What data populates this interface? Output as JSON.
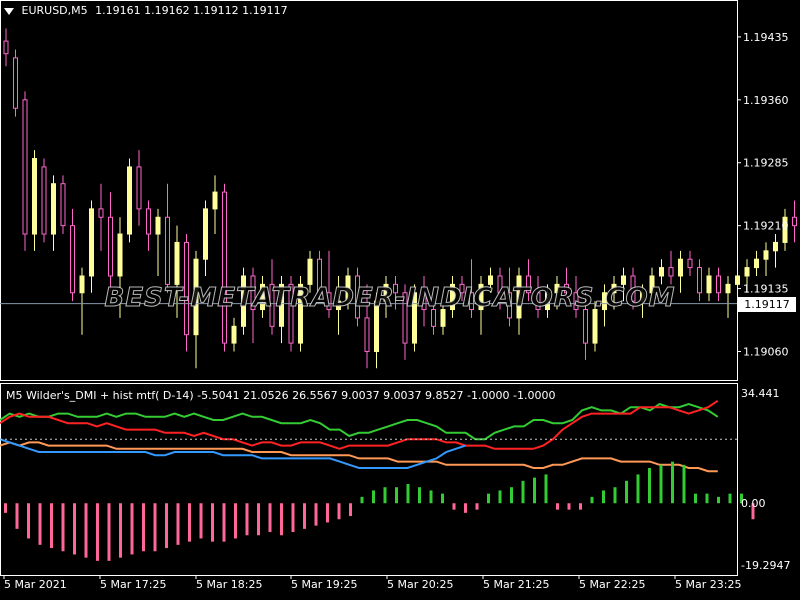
{
  "main_chart": {
    "symbol": "EURUSD,M5",
    "ohlc": [
      "1.19161",
      "1.19162",
      "1.19112",
      "1.19117"
    ],
    "current_price": "1.19117",
    "watermark": "BEST-METATRADER-INDICATORS.COM",
    "colors": {
      "bull": "#ffff99",
      "bear": "#ff66cc",
      "price_line": "#8899aa",
      "price_box": "#ffffff"
    }
  },
  "indicator": {
    "header": "M5 Wilder's_DMI + hist mtf( D-14) -5.5041 21.0526 26.5567 9.0037 9.0037 9.8527 -1.0000 -1.0000",
    "colors": {
      "plus_di": "#33cc33",
      "minus_di": "#ff2222",
      "adx": "#ff9955",
      "adxr": "#3399ff",
      "hist_pos": "#33cc33",
      "hist_neg": "#ff6699"
    }
  },
  "chart_data": [
    {
      "type": "candlestick",
      "title": "EURUSD,M5",
      "y_ticks": [
        "1.19435",
        "1.19360",
        "1.19285",
        "1.19210",
        "1.19135",
        "1.19060"
      ],
      "ylim": [
        1.19026,
        1.19479
      ],
      "x_ticks": [
        "5 Mar 2021",
        "5 Mar 17:25",
        "5 Mar 18:25",
        "5 Mar 19:25",
        "5 Mar 20:25",
        "5 Mar 21:25",
        "5 Mar 22:25",
        "5 Mar 23:25"
      ],
      "current_price": 1.19117,
      "candles": [
        [
          1.1943,
          1.19445,
          1.194,
          1.19415
        ],
        [
          1.1941,
          1.1942,
          1.1934,
          1.1935
        ],
        [
          1.1936,
          1.1937,
          1.1918,
          1.192
        ],
        [
          1.192,
          1.193,
          1.1918,
          1.1929
        ],
        [
          1.1928,
          1.1929,
          1.1919,
          1.192
        ],
        [
          1.192,
          1.1927,
          1.1918,
          1.1926
        ],
        [
          1.1926,
          1.1927,
          1.192,
          1.1921
        ],
        [
          1.1921,
          1.1923,
          1.1912,
          1.1913
        ],
        [
          1.1913,
          1.1916,
          1.1908,
          1.1915
        ],
        [
          1.1915,
          1.1924,
          1.1913,
          1.1923
        ],
        [
          1.1923,
          1.1926,
          1.1918,
          1.1922
        ],
        [
          1.1922,
          1.1925,
          1.1913,
          1.1915
        ],
        [
          1.1915,
          1.1922,
          1.191,
          1.192
        ],
        [
          1.192,
          1.1929,
          1.1919,
          1.1928
        ],
        [
          1.1928,
          1.193,
          1.1921,
          1.1923
        ],
        [
          1.1923,
          1.1924,
          1.1918,
          1.192
        ],
        [
          1.192,
          1.1923,
          1.1915,
          1.1922
        ],
        [
          1.1922,
          1.1926,
          1.1913,
          1.1914
        ],
        [
          1.1914,
          1.1921,
          1.191,
          1.1919
        ],
        [
          1.1919,
          1.192,
          1.1906,
          1.1908
        ],
        [
          1.1908,
          1.1918,
          1.1904,
          1.1917
        ],
        [
          1.1917,
          1.1924,
          1.1915,
          1.1923
        ],
        [
          1.1923,
          1.1927,
          1.192,
          1.1925
        ],
        [
          1.1925,
          1.1926,
          1.1906,
          1.1907
        ],
        [
          1.1907,
          1.191,
          1.1906,
          1.1909
        ],
        [
          1.1909,
          1.1916,
          1.1908,
          1.1915
        ],
        [
          1.1915,
          1.1916,
          1.1907,
          1.1911
        ],
        [
          1.1911,
          1.1915,
          1.191,
          1.1914
        ],
        [
          1.1914,
          1.1917,
          1.1908,
          1.1909
        ],
        [
          1.1909,
          1.1915,
          1.1907,
          1.1914
        ],
        [
          1.1914,
          1.1915,
          1.1906,
          1.1907
        ],
        [
          1.1907,
          1.1915,
          1.1906,
          1.1914
        ],
        [
          1.1914,
          1.1918,
          1.1913,
          1.1917
        ],
        [
          1.1917,
          1.1918,
          1.1912,
          1.1913
        ],
        [
          1.1913,
          1.1918,
          1.191,
          1.1911
        ],
        [
          1.1911,
          1.1915,
          1.1908,
          1.1912
        ],
        [
          1.1912,
          1.1916,
          1.1911,
          1.1915
        ],
        [
          1.1915,
          1.1916,
          1.1909,
          1.191
        ],
        [
          1.191,
          1.1914,
          1.1904,
          1.1906
        ],
        [
          1.1906,
          1.1913,
          1.1904,
          1.1912
        ],
        [
          1.1912,
          1.1915,
          1.191,
          1.1914
        ],
        [
          1.1914,
          1.1915,
          1.1911,
          1.1913
        ],
        [
          1.1913,
          1.1914,
          1.1905,
          1.1907
        ],
        [
          1.1907,
          1.1914,
          1.1906,
          1.1913
        ],
        [
          1.1913,
          1.1915,
          1.1909,
          1.1911
        ],
        [
          1.1911,
          1.1913,
          1.1908,
          1.1909
        ],
        [
          1.1909,
          1.1912,
          1.1908,
          1.1911
        ],
        [
          1.1911,
          1.1915,
          1.191,
          1.1914
        ],
        [
          1.1914,
          1.1915,
          1.1912,
          1.1913
        ],
        [
          1.1913,
          1.1917,
          1.191,
          1.1911
        ],
        [
          1.1911,
          1.1915,
          1.1908,
          1.1914
        ],
        [
          1.1914,
          1.1916,
          1.1913,
          1.1915
        ],
        [
          1.1915,
          1.1916,
          1.1911,
          1.1913
        ],
        [
          1.1913,
          1.1916,
          1.1909,
          1.191
        ],
        [
          1.191,
          1.1916,
          1.1908,
          1.1915
        ],
        [
          1.1915,
          1.1917,
          1.1912,
          1.1913
        ],
        [
          1.1913,
          1.1915,
          1.191,
          1.1911
        ],
        [
          1.1911,
          1.1914,
          1.191,
          1.1913
        ],
        [
          1.1913,
          1.1915,
          1.1911,
          1.1914
        ],
        [
          1.1914,
          1.1916,
          1.1912,
          1.1913
        ],
        [
          1.1913,
          1.1915,
          1.191,
          1.1911
        ],
        [
          1.1911,
          1.1913,
          1.1905,
          1.1907
        ],
        [
          1.1907,
          1.1912,
          1.1906,
          1.1911
        ],
        [
          1.1911,
          1.1914,
          1.1909,
          1.1913
        ],
        [
          1.1913,
          1.1915,
          1.1911,
          1.1914
        ],
        [
          1.1914,
          1.1916,
          1.1912,
          1.1915
        ],
        [
          1.1915,
          1.1916,
          1.1911,
          1.1912
        ],
        [
          1.1912,
          1.1914,
          1.191,
          1.1913
        ],
        [
          1.1913,
          1.1916,
          1.1912,
          1.1915
        ],
        [
          1.1915,
          1.1917,
          1.1914,
          1.1916
        ],
        [
          1.1916,
          1.1918,
          1.1914,
          1.1915
        ],
        [
          1.1915,
          1.1918,
          1.1913,
          1.1917
        ],
        [
          1.1917,
          1.1918,
          1.1915,
          1.1916
        ],
        [
          1.1916,
          1.1917,
          1.1912,
          1.1913
        ],
        [
          1.1913,
          1.1916,
          1.1912,
          1.1915
        ],
        [
          1.1915,
          1.1916,
          1.1912,
          1.1913
        ],
        [
          1.1913,
          1.1915,
          1.191,
          1.1914
        ],
        [
          1.1914,
          1.1916,
          1.1912,
          1.1915
        ],
        [
          1.1915,
          1.1917,
          1.1913,
          1.1916
        ],
        [
          1.1916,
          1.1918,
          1.1915,
          1.1917
        ],
        [
          1.1917,
          1.1919,
          1.1915,
          1.1918
        ],
        [
          1.1918,
          1.192,
          1.1916,
          1.1919
        ],
        [
          1.1919,
          1.1923,
          1.1918,
          1.1922
        ],
        [
          1.1922,
          1.1924,
          1.1919,
          1.1921
        ],
        [
          1.1921,
          1.1923,
          1.1919,
          1.192
        ],
        [
          1.192,
          1.1922,
          1.1917,
          1.1918
        ],
        [
          1.1918,
          1.1921,
          1.1917,
          1.192
        ],
        [
          1.192,
          1.1923,
          1.1919,
          1.1922
        ],
        [
          1.1922,
          1.1924,
          1.1917,
          1.1918
        ],
        [
          1.1918,
          1.192,
          1.1915,
          1.1916
        ],
        [
          1.1916,
          1.192,
          1.1915,
          1.1919
        ],
        [
          1.1919,
          1.192,
          1.1914,
          1.1915
        ],
        [
          1.1915,
          1.1918,
          1.1914,
          1.1917
        ],
        [
          1.1917,
          1.1919,
          1.1916,
          1.1918
        ],
        [
          1.1918,
          1.1921,
          1.1917,
          1.192
        ],
        [
          1.192,
          1.1921,
          1.1916,
          1.1917
        ],
        [
          1.1917,
          1.1918,
          1.191,
          1.19117
        ]
      ]
    },
    {
      "type": "line",
      "title": "M5 Wilder's_DMI + hist mtf( D-14)",
      "y_ticks": [
        "34.441",
        "0.00",
        "-19.2947"
      ],
      "ylim": [
        -19.2947,
        34.441
      ],
      "level": 20,
      "series": [
        {
          "values": [
            26,
            28,
            27,
            28,
            27,
            27,
            28,
            28,
            27,
            27,
            27,
            28,
            27,
            28,
            28,
            27,
            27,
            27,
            28,
            27,
            28,
            27,
            26,
            26,
            27,
            28,
            27,
            27,
            26,
            25,
            25,
            25,
            26,
            25,
            23,
            23,
            21,
            22,
            22,
            23,
            24,
            25,
            26,
            26,
            25,
            24,
            22,
            22,
            22,
            20,
            20,
            22,
            23,
            24,
            24,
            26,
            26,
            25,
            25,
            26,
            29,
            30,
            29,
            29,
            28,
            30,
            30,
            29,
            31,
            30,
            30,
            31,
            30,
            29,
            27
          ]
        },
        {
          "values": [
            25,
            27,
            28,
            27,
            27,
            27,
            26,
            25,
            25,
            25,
            24,
            25,
            24,
            23,
            23,
            23,
            23,
            22,
            22,
            22,
            21,
            22,
            21,
            20,
            20,
            19,
            18,
            19,
            19,
            18,
            18,
            19,
            19,
            19,
            18,
            17,
            18,
            18,
            18,
            18,
            18,
            19,
            20,
            20,
            20,
            20,
            19,
            19,
            18,
            18,
            18,
            17,
            17,
            17,
            17,
            17,
            18,
            20,
            23,
            25,
            27,
            28,
            28,
            28,
            28,
            28,
            30,
            30,
            30,
            30,
            29,
            28,
            29,
            30,
            32
          ]
        },
        {
          "values": [
            18,
            19,
            18,
            19,
            19,
            18,
            18,
            18,
            18,
            18,
            18,
            18,
            17,
            17,
            17,
            17,
            17,
            17,
            17,
            17,
            17,
            17,
            17,
            17,
            17,
            17,
            16,
            16,
            16,
            16,
            15,
            15,
            15,
            15,
            15,
            15,
            15,
            14,
            14,
            14,
            14,
            13,
            13,
            13,
            13,
            13,
            12,
            12,
            12,
            12,
            12,
            12,
            12,
            12,
            12,
            11,
            11,
            12,
            12,
            13,
            14,
            14,
            14,
            14,
            13,
            13,
            13,
            13,
            12,
            12,
            12,
            11,
            11,
            10,
            10
          ]
        },
        {
          "values": [
            20,
            19,
            18,
            17,
            16,
            16,
            16,
            16,
            16,
            16,
            16,
            16,
            16,
            16,
            16,
            16,
            15,
            15,
            16,
            16,
            16,
            16,
            16,
            15,
            15,
            15,
            15,
            14,
            14,
            14,
            14,
            14,
            13,
            12,
            11,
            11,
            11,
            11,
            11,
            11,
            12,
            13,
            14,
            16,
            17,
            18
          ]
        }
      ],
      "histogram": [
        -3,
        -8,
        -11,
        -13,
        -14,
        -15,
        -16,
        -17,
        -18,
        -18,
        -17,
        -16,
        -15,
        -15,
        -14,
        -13,
        -12,
        -11,
        -12,
        -12,
        -11,
        -10,
        -10,
        -9,
        -10,
        -9,
        -8,
        -7,
        -6,
        -5,
        -4,
        2,
        4,
        5,
        5,
        6,
        5,
        4,
        3,
        -2,
        -3,
        -2,
        3,
        4,
        5,
        7,
        8,
        9,
        -2,
        -2,
        -2,
        2,
        4,
        5,
        7,
        9,
        11,
        12,
        13,
        12,
        3,
        3,
        2,
        3,
        3,
        -5
      ]
    }
  ]
}
